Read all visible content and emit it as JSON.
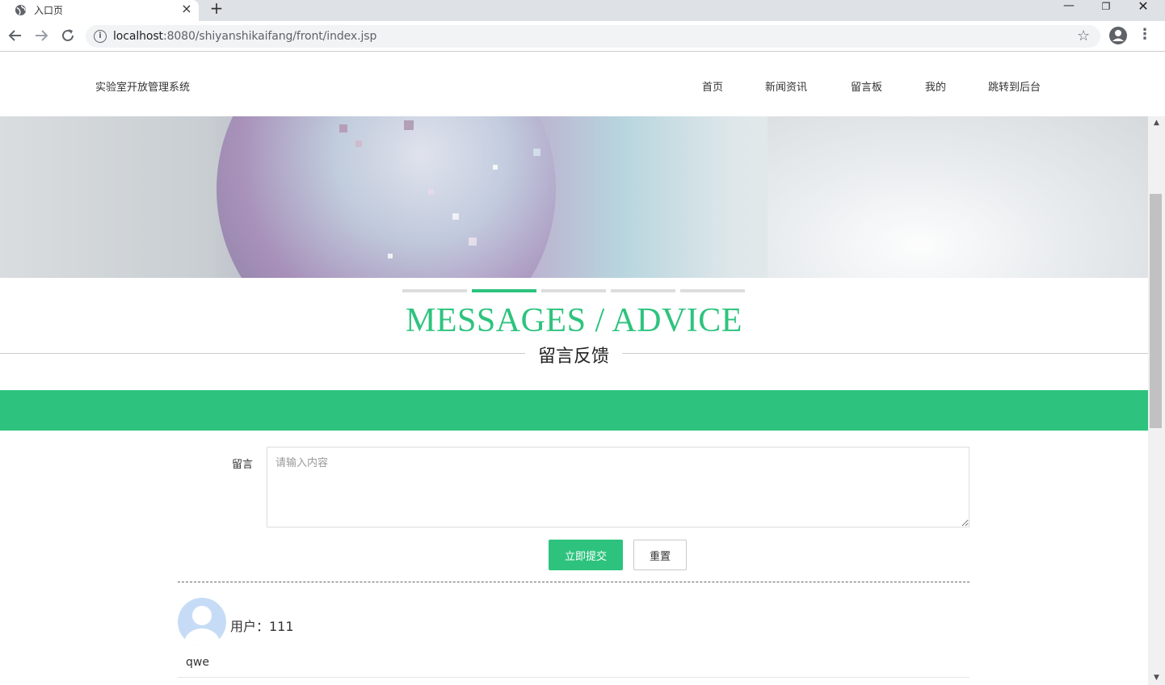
{
  "browser": {
    "tab_title": "入口页",
    "tab_close": "×",
    "new_tab": "+",
    "url_host": "localhost",
    "url_rest": ":8080/shiyanshikaifang/front/index.jsp",
    "window_min": "—",
    "window_max": "❐",
    "window_close": "✕",
    "icons": [
      "globe-icon",
      "back-icon",
      "forward-icon",
      "reload-icon",
      "info-icon",
      "star-icon",
      "profile-icon",
      "menu-icon"
    ]
  },
  "site": {
    "title": "实验室开放管理系统",
    "nav": [
      "首页",
      "新闻资讯",
      "留言板",
      "我的",
      "跳转到后台"
    ]
  },
  "slider": {
    "count": 5,
    "active_index": 1
  },
  "section": {
    "heading_en": "MESSAGES / ADVICE",
    "heading_cn": "留言反馈"
  },
  "form": {
    "label": "留言",
    "placeholder": "请输入内容",
    "submit_label": "立即提交",
    "reset_label": "重置"
  },
  "messages": [
    {
      "user": "用户：111",
      "content": "qwe"
    }
  ],
  "colors": {
    "accent": "#2dc37e",
    "avatar": "#c6dcf6"
  }
}
